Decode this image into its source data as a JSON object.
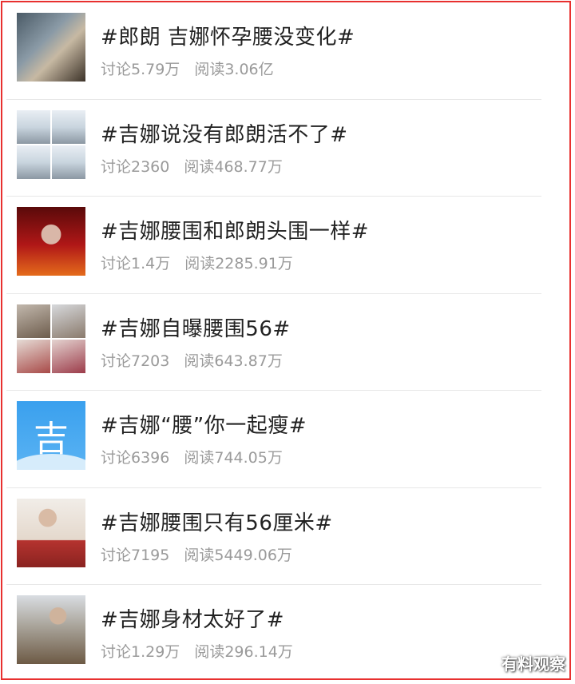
{
  "items": [
    {
      "title": "#郎朗 吉娜怀孕腰没变化#",
      "discuss": "讨论5.79万",
      "read": "阅读3.06亿",
      "thumb": "photo-couple"
    },
    {
      "title": "#吉娜说没有郎朗活不了#",
      "discuss": "讨论2360",
      "read": "阅读468.77万",
      "thumb": "video-grid"
    },
    {
      "title": "#吉娜腰围和郎朗头围一样#",
      "discuss": "讨论1.4万",
      "read": "阅读2285.91万",
      "thumb": "stage-photo"
    },
    {
      "title": "#吉娜自曝腰围56#",
      "discuss": "讨论7203",
      "read": "阅读643.87万",
      "thumb": "photo-grid"
    },
    {
      "title": "#吉娜“腰”你一起瘦#",
      "discuss": "讨论6396",
      "read": "阅读744.05万",
      "thumb": "topic-icon",
      "thumb_glyph": "吉"
    },
    {
      "title": "#吉娜腰围只有56厘米#",
      "discuss": "讨论7195",
      "read": "阅读5449.06万",
      "thumb": "portrait-photo"
    },
    {
      "title": "#吉娜身材太好了#",
      "discuss": "讨论1.29万",
      "read": "阅读296.14万",
      "thumb": "office-photo"
    }
  ],
  "watermark": "有料观察",
  "colors": {
    "frame": "#e8302f",
    "title": "#222222",
    "meta": "#9a9a9a",
    "icon_bg": "#3aa0ee"
  }
}
